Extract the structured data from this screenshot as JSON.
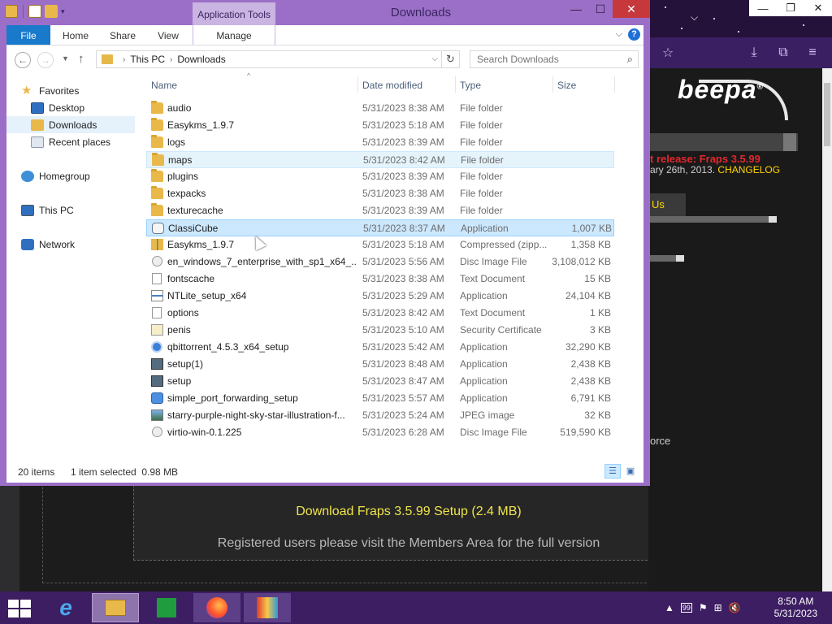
{
  "window": {
    "title": "Downloads",
    "app_tools_label": "Application Tools",
    "minimize": "—",
    "maximize": "☐",
    "close": "✕"
  },
  "ribbon": {
    "tabs": [
      "File",
      "Home",
      "Share",
      "View",
      "Manage"
    ],
    "help": "?"
  },
  "address": {
    "crumbs": [
      "This PC",
      "Downloads"
    ],
    "search_placeholder": "Search Downloads"
  },
  "navpane": {
    "items": [
      {
        "label": "Favorites",
        "icon": "star-icon"
      },
      {
        "label": "Desktop",
        "icon": "desktop-icon"
      },
      {
        "label": "Downloads",
        "icon": "downloads-folder-icon",
        "selected": true
      },
      {
        "label": "Recent places",
        "icon": "recent-places-icon"
      },
      {
        "label": "Homegroup",
        "icon": "homegroup-icon"
      },
      {
        "label": "This PC",
        "icon": "computer-icon"
      },
      {
        "label": "Network",
        "icon": "network-icon"
      }
    ]
  },
  "columns": {
    "name": "Name",
    "date": "Date modified",
    "type": "Type",
    "size": "Size"
  },
  "files": [
    {
      "name": "audio",
      "date": "5/31/2023 8:38 AM",
      "type": "File folder",
      "size": "",
      "icon": "folder-icon"
    },
    {
      "name": "Easykms_1.9.7",
      "date": "5/31/2023 5:18 AM",
      "type": "File folder",
      "size": "",
      "icon": "folder-icon"
    },
    {
      "name": "logs",
      "date": "5/31/2023 8:39 AM",
      "type": "File folder",
      "size": "",
      "icon": "folder-icon"
    },
    {
      "name": "maps",
      "date": "5/31/2023 8:42 AM",
      "type": "File folder",
      "size": "",
      "icon": "folder-icon",
      "state": "hover"
    },
    {
      "name": "plugins",
      "date": "5/31/2023 8:39 AM",
      "type": "File folder",
      "size": "",
      "icon": "folder-icon"
    },
    {
      "name": "texpacks",
      "date": "5/31/2023 8:38 AM",
      "type": "File folder",
      "size": "",
      "icon": "folder-icon"
    },
    {
      "name": "texturecache",
      "date": "5/31/2023 8:39 AM",
      "type": "File folder",
      "size": "",
      "icon": "folder-icon"
    },
    {
      "name": "ClassiCube",
      "date": "5/31/2023 8:37 AM",
      "type": "Application",
      "size": "1,007 KB",
      "icon": "app-icon",
      "state": "selected"
    },
    {
      "name": "Easykms_1.9.7",
      "date": "5/31/2023 5:18 AM",
      "type": "Compressed (zipp...",
      "size": "1,358 KB",
      "icon": "zip-icon"
    },
    {
      "name": "en_windows_7_enterprise_with_sp1_x64_...",
      "date": "5/31/2023 5:56 AM",
      "type": "Disc Image File",
      "size": "3,108,012 KB",
      "icon": "disc-image-icon"
    },
    {
      "name": "fontscache",
      "date": "5/31/2023 8:38 AM",
      "type": "Text Document",
      "size": "15 KB",
      "icon": "text-document-icon"
    },
    {
      "name": "NTLite_setup_x64",
      "date": "5/31/2023 5:29 AM",
      "type": "Application",
      "size": "24,104 KB",
      "icon": "setup-icon"
    },
    {
      "name": "options",
      "date": "5/31/2023 8:42 AM",
      "type": "Text Document",
      "size": "1 KB",
      "icon": "text-document-icon"
    },
    {
      "name": "penis",
      "date": "5/31/2023 5:10 AM",
      "type": "Security Certificate",
      "size": "3 KB",
      "icon": "certificate-icon"
    },
    {
      "name": "qbittorrent_4.5.3_x64_setup",
      "date": "5/31/2023 5:42 AM",
      "type": "Application",
      "size": "32,290 KB",
      "icon": "qbittorrent-icon"
    },
    {
      "name": "setup(1)",
      "date": "5/31/2023 8:48 AM",
      "type": "Application",
      "size": "2,438 KB",
      "icon": "installer-icon"
    },
    {
      "name": "setup",
      "date": "5/31/2023 8:47 AM",
      "type": "Application",
      "size": "2,438 KB",
      "icon": "installer-icon"
    },
    {
      "name": "simple_port_forwarding_setup",
      "date": "5/31/2023 5:57 AM",
      "type": "Application",
      "size": "6,791 KB",
      "icon": "globe-app-icon"
    },
    {
      "name": "starry-purple-night-sky-star-illustration-f...",
      "date": "5/31/2023 5:24 AM",
      "type": "JPEG image",
      "size": "32 KB",
      "icon": "image-icon"
    },
    {
      "name": "virtio-win-0.1.225",
      "date": "5/31/2023 6:28 AM",
      "type": "Disc Image File",
      "size": "519,590 KB",
      "icon": "disc-image-icon"
    }
  ],
  "status": {
    "count": "20 items",
    "selection": "1 item selected  0.98 MB"
  },
  "website": {
    "logo": "beepa",
    "logo_mark": "®",
    "release": "t release: Fraps 3.5.99",
    "release_date": "ary 26th, 2013.",
    "changelog": "CHANGELOG",
    "contact_tab": "Us",
    "force_text": "orce",
    "download_link": "Download Fraps 3.5.99 Setup (2.4 MB)",
    "members_text": "Registered users please visit the Members Area for the full version"
  },
  "taskbar": {
    "clock_time": "8:50 AM",
    "clock_date": "5/31/2023"
  },
  "colors": {
    "window_frame": "#9b6fc7",
    "taskbar": "#3d1e62",
    "selection": "#cce8ff",
    "accent_blue": "#1979ca",
    "link_yellow": "#f0e44a"
  }
}
